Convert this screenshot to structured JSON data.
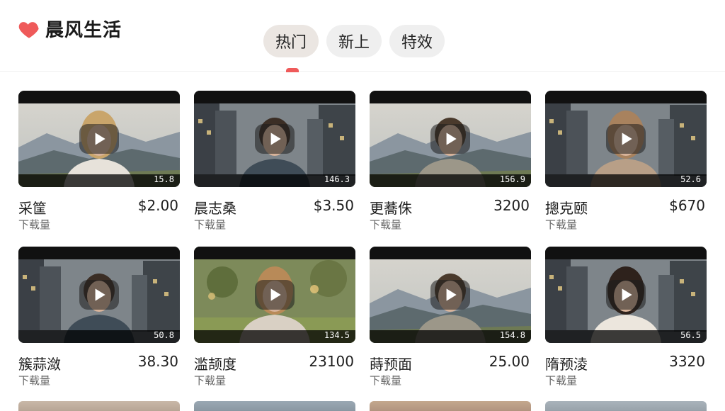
{
  "app": {
    "title": "晨风生活",
    "logo_icon": "heart-icon",
    "accent": "#ef5a5a"
  },
  "tabs": [
    {
      "label": "热门",
      "active": true
    },
    {
      "label": "新上",
      "active": false
    },
    {
      "label": "特效",
      "active": false
    }
  ],
  "cards": [
    {
      "title": "采筐",
      "price": "$2.00",
      "sub": "下载量",
      "duration": "15.8",
      "scene": "mountain",
      "person": "woman-blonde"
    },
    {
      "title": "晨志桑",
      "price": "$3.50",
      "sub": "下载量",
      "duration": "146.3",
      "scene": "city",
      "person": "man-hoodie"
    },
    {
      "title": "更蕎侏",
      "price": "3200",
      "sub": "下载量",
      "duration": "156.9",
      "scene": "mountain",
      "person": "man-jacket"
    },
    {
      "title": "摠克颐",
      "price": "$670",
      "sub": "下载量",
      "duration": "52.6",
      "scene": "city",
      "person": "woman-scarf"
    },
    {
      "title": "簇蒜潋",
      "price": "38.30",
      "sub": "下载量",
      "duration": "50.8",
      "scene": "city",
      "person": "man-hoodie"
    },
    {
      "title": "滥颉度",
      "price": "23100",
      "sub": "下载量",
      "duration": "134.5",
      "scene": "forest",
      "person": "woman-wavy"
    },
    {
      "title": "蒔预面",
      "price": "25.00",
      "sub": "下载量",
      "duration": "154.8",
      "scene": "mountain",
      "person": "man-jacket"
    },
    {
      "title": "隋预淩",
      "price": "3320",
      "sub": "下载量",
      "duration": "56.5",
      "scene": "city",
      "person": "woman-dark"
    }
  ]
}
